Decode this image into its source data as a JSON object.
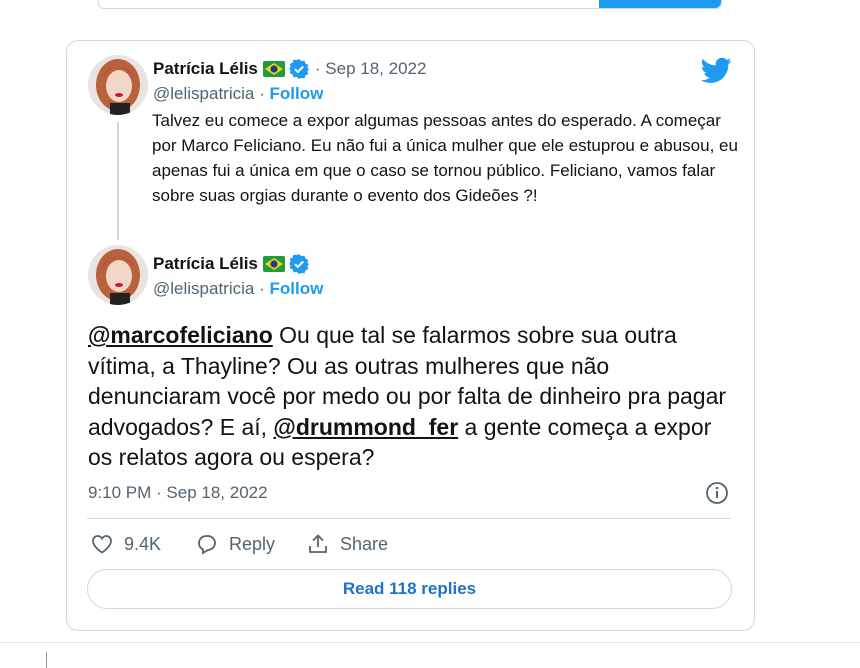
{
  "quoted_tweet": {
    "author_name": "Patrícia Lélis",
    "handle": "@lelispatricia",
    "separator": "·",
    "follow_label": "Follow",
    "date_prefix": "·",
    "date": "Sep 18, 2022",
    "text": "Talvez eu comece a expor algumas pessoas antes do esperado. A começar por Marco Feliciano. Eu não fui a única mulher que ele estuprou e abusou, eu apenas fui a única em que o caso se tornou público. Feliciano, vamos falar sobre suas orgias durante o evento dos Gideões ?!"
  },
  "main_tweet": {
    "author_name": "Patrícia Lélis",
    "handle": "@lelispatricia",
    "separator": "·",
    "follow_label": "Follow",
    "mention_1": "@marcofeliciano",
    "text_1": " Ou que tal se falarmos sobre sua outra vítima, a Thayline? Ou as outras mulheres que não denunciaram você por medo ou por falta de dinheiro pra pagar advogados? E aí, ",
    "mention_2": "@drummond_fer",
    "text_2": " a gente começa a expor os relatos agora ou espera?",
    "timestamp": "9:10 PM · Sep 18, 2022"
  },
  "actions": {
    "like_count": "9.4K",
    "reply_label": "Reply",
    "share_label": "Share"
  },
  "read_replies_label": "Read 118 replies",
  "colors": {
    "accent": "#1d9bf0",
    "text": "#0f1419",
    "muted": "#536471",
    "border": "#cfd9de"
  },
  "icons": [
    "twitter-bird-icon",
    "verified-badge-icon",
    "brazil-flag-icon",
    "info-icon",
    "heart-icon",
    "reply-bubble-icon",
    "share-icon"
  ]
}
